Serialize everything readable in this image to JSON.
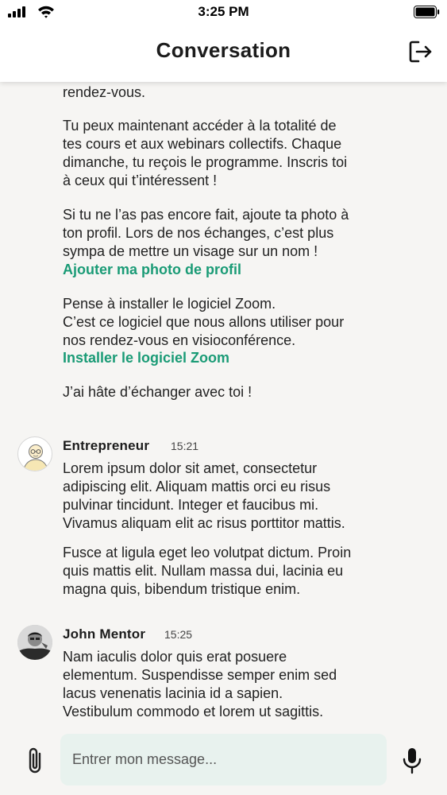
{
  "status": {
    "time": "3:25 PM"
  },
  "header": {
    "title": "Conversation"
  },
  "messages": {
    "first": {
      "p0": "rendez-vous.",
      "p1_l1": "Tu peux maintenant accéder à la totalité de",
      "p1_l2": "tes cours et aux webinars collectifs. Chaque",
      "p1_l3": "dimanche, tu reçois le programme. Inscris toi",
      "p1_l4": "à ceux qui t’intéressent !",
      "p2_l1": "Si tu ne l’as pas encore fait, ajoute ta photo à",
      "p2_l2": "ton profil. Lors de nos échanges, c’est plus",
      "p2_l3": "sympa de mettre un visage sur un nom !",
      "photo_link": "Ajouter ma photo de profil",
      "p3_l1": "Pense à installer le logiciel Zoom.",
      "p3_l2": "C’est ce logiciel que nous allons utiliser pour",
      "p3_l3": "nos rendez-vous en visioconférence.",
      "zoom_link": "Installer le logiciel Zoom",
      "p4": "J’ai hâte d’échanger avec toi !"
    },
    "entrepreneur": {
      "author": "Entrepreneur",
      "time": "15:21",
      "p1_l1": "Lorem ipsum dolor sit amet, consectetur",
      "p1_l2": "adipiscing elit. Aliquam mattis orci eu risus",
      "p1_l3": "pulvinar tincidunt. Integer et faucibus mi.",
      "p1_l4": "Vivamus aliquam elit ac risus porttitor mattis.",
      "p2_l1": "Fusce at ligula eget leo volutpat dictum. Proin",
      "p2_l2": "quis mattis elit. Nullam massa dui, lacinia eu",
      "p2_l3": "magna quis, bibendum tristique enim."
    },
    "mentor": {
      "author": "John Mentor",
      "time": "15:25",
      "p1_l1": "Nam iaculis dolor quis erat posuere",
      "p1_l2": "elementum. Suspendisse semper enim sed",
      "p1_l3": "lacus venenatis lacinia id a sapien.",
      "p1_l4": "Vestibulum commodo et lorem ut sagittis."
    }
  },
  "composer": {
    "placeholder": "Entrer mon message..."
  },
  "icons": {
    "logout": "logout-icon",
    "attach": "paperclip-icon",
    "mic": "microphone-icon"
  },
  "colors": {
    "link": "#1a9b76",
    "input_bg": "#e8f2ee",
    "page_bg": "#f6f5f3"
  }
}
